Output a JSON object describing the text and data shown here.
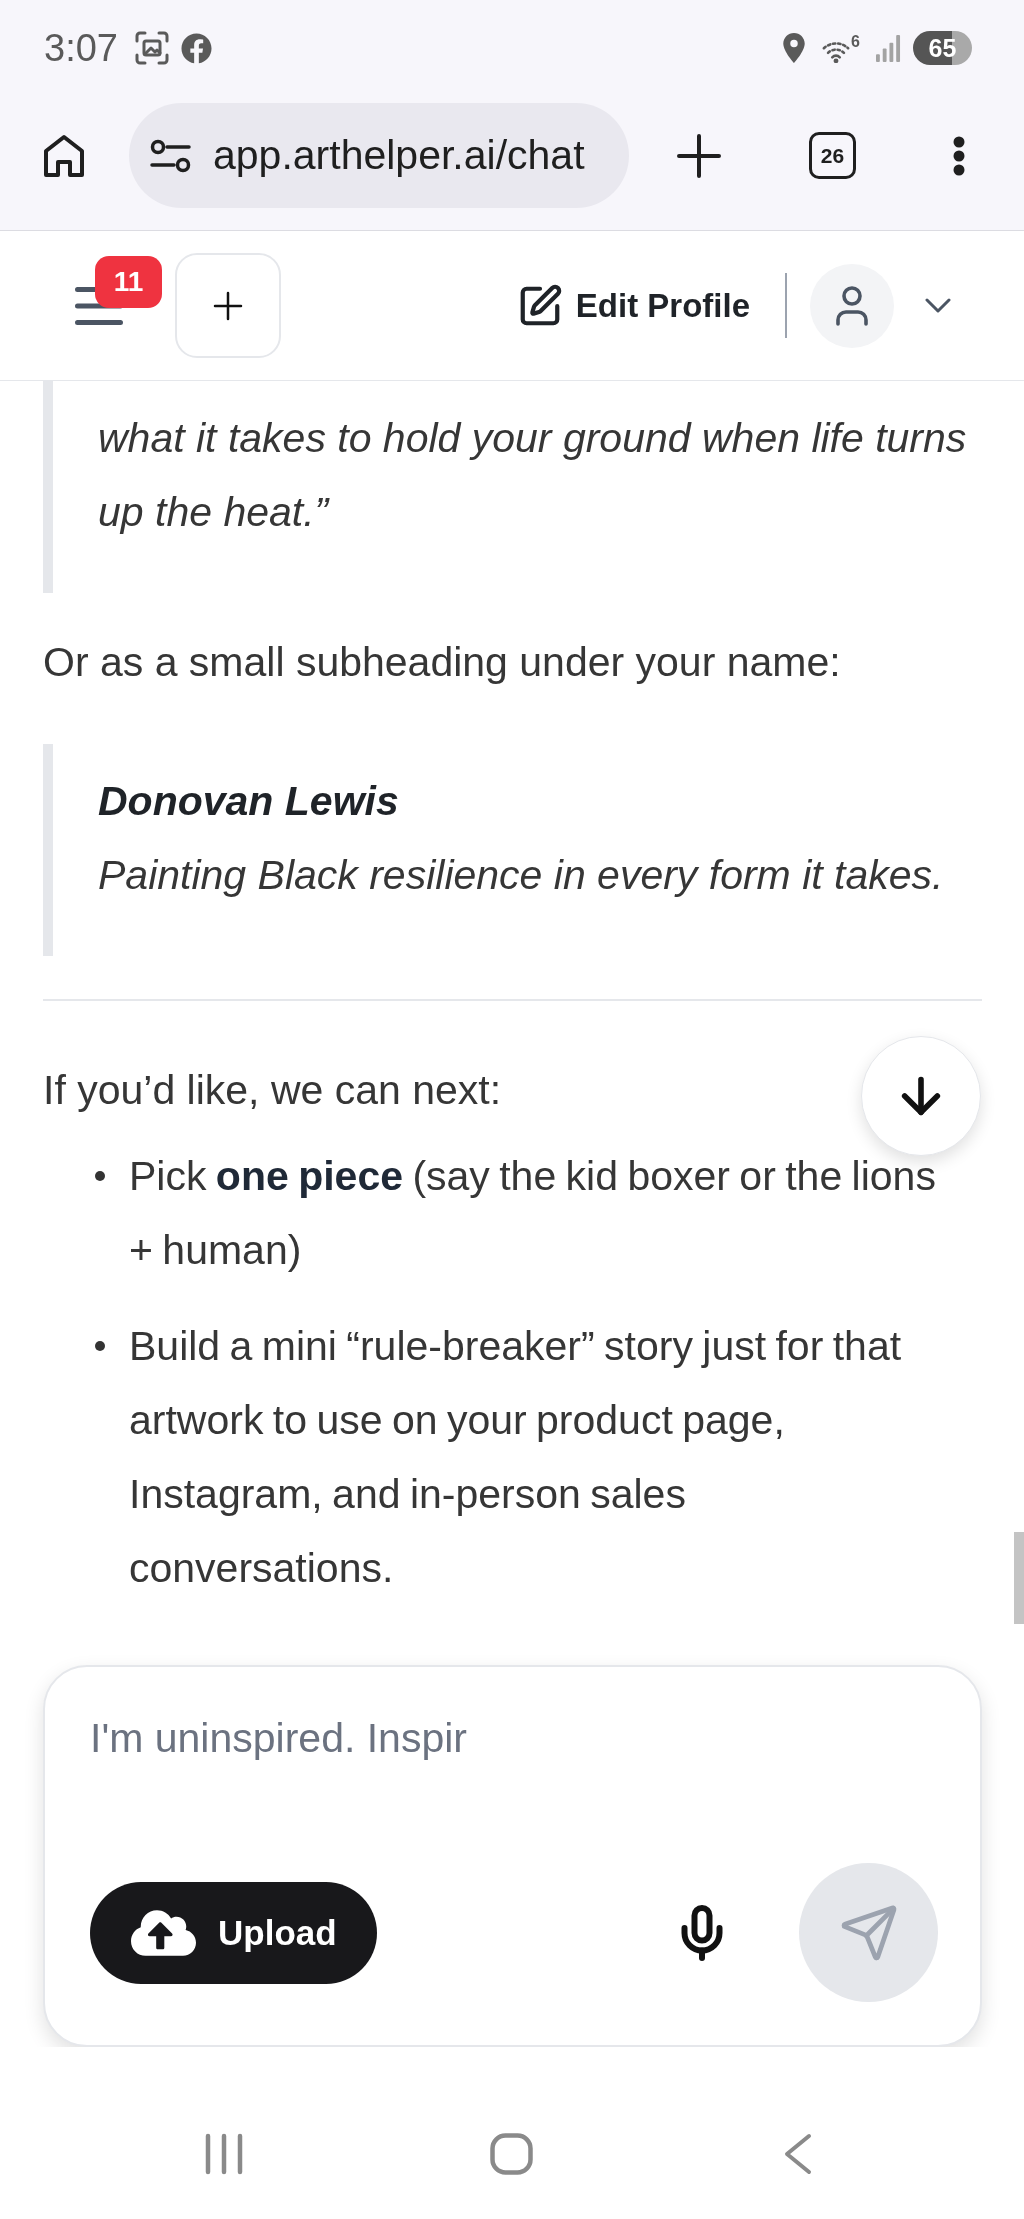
{
  "status_bar": {
    "time": "3:07",
    "wifi_badge": "6",
    "battery": "65"
  },
  "browser": {
    "url": "app.arthelper.ai/chat",
    "tab_count": "26"
  },
  "header": {
    "notification_count": "11",
    "edit_profile": "Edit Profile"
  },
  "message": {
    "blocks": [
      {
        "kind": "quote",
        "text": "what it takes to hold your ground when life turns up the heat.”"
      },
      {
        "kind": "paragraph",
        "text": "Or as a small subheading under your name:"
      },
      {
        "kind": "signature",
        "name": "Donovan Lewis",
        "tagline": "Painting Black resilience in every form it takes."
      },
      {
        "kind": "rule"
      },
      {
        "kind": "paragraph",
        "text": "If you’d like, we can next:"
      },
      {
        "kind": "list",
        "items": [
          "Pick **one piece** (say the kid boxer or the lions + human)",
          "Build a mini “rule-breaker” story just for that artwork to use on your product page, Instagram, and in-person sales conversations."
        ]
      }
    ]
  },
  "composer": {
    "placeholder": "I'm uninspired. Inspir",
    "upload": "Upload"
  }
}
